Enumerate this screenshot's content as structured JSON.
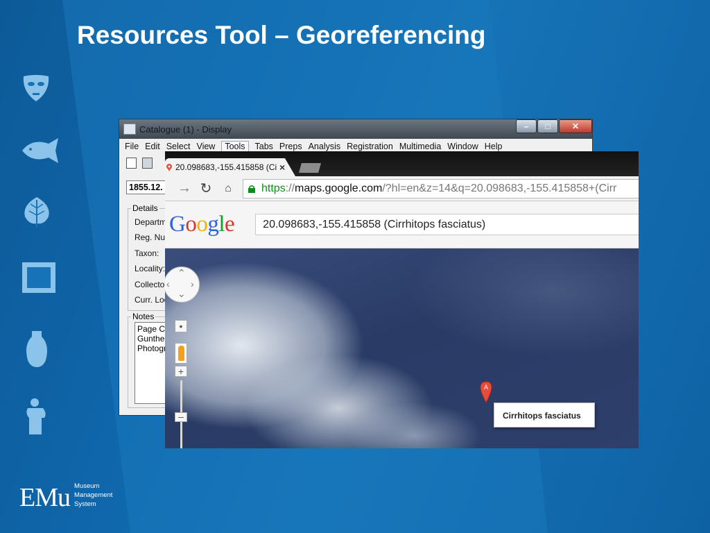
{
  "slide": {
    "title": "Resources Tool – Georeferencing",
    "logo": {
      "mark": "EMu",
      "line1": "Museum",
      "line2": "Management",
      "line3": "System"
    }
  },
  "side_icons": [
    "mask-icon",
    "fish-icon",
    "leaf-icon",
    "frame-icon",
    "vase-icon",
    "statue-icon"
  ],
  "catalogue": {
    "title": "Catalogue (1) - Display",
    "window_buttons": {
      "minimize": "–",
      "maximize": "□",
      "close": "✕"
    },
    "menu": [
      "File",
      "Edit",
      "Select",
      "View",
      "Tools",
      "Tabs",
      "Preps",
      "Analysis",
      "Registration",
      "Multimedia",
      "Window",
      "Help"
    ],
    "active_menu": "Tools",
    "reg_number": "1855.12.",
    "details_legend": "Details",
    "fields": [
      "Departm",
      "Reg. Nu",
      "Taxon:",
      "Locality:",
      "Collector",
      "Curr. Loc"
    ],
    "notes_legend": "Notes",
    "notes_lines": [
      "Page Co",
      "Gunther",
      "Photogr"
    ]
  },
  "browser": {
    "tab_title": "20.098683,-155.415858 (Ci",
    "tab_close": "×",
    "url_scheme": "https",
    "url_host": "maps.google.com",
    "url_path": "/?hl=en&z=14&q=20.098683,-155.415858+(Cirr",
    "google_logo": [
      "G",
      "o",
      "o",
      "g",
      "l",
      "e"
    ],
    "search_value": "20.098683,-155.415858 (Cirrhitops fasciatus)",
    "zoom_in": "+",
    "zoom_out": "–",
    "marker_label": "A",
    "info_window": "Cirrhitops fasciatus"
  },
  "colors": {
    "slide_bg": "#0e5d9c",
    "https_green": "#108a1c",
    "marker_red": "#e74c3c"
  }
}
